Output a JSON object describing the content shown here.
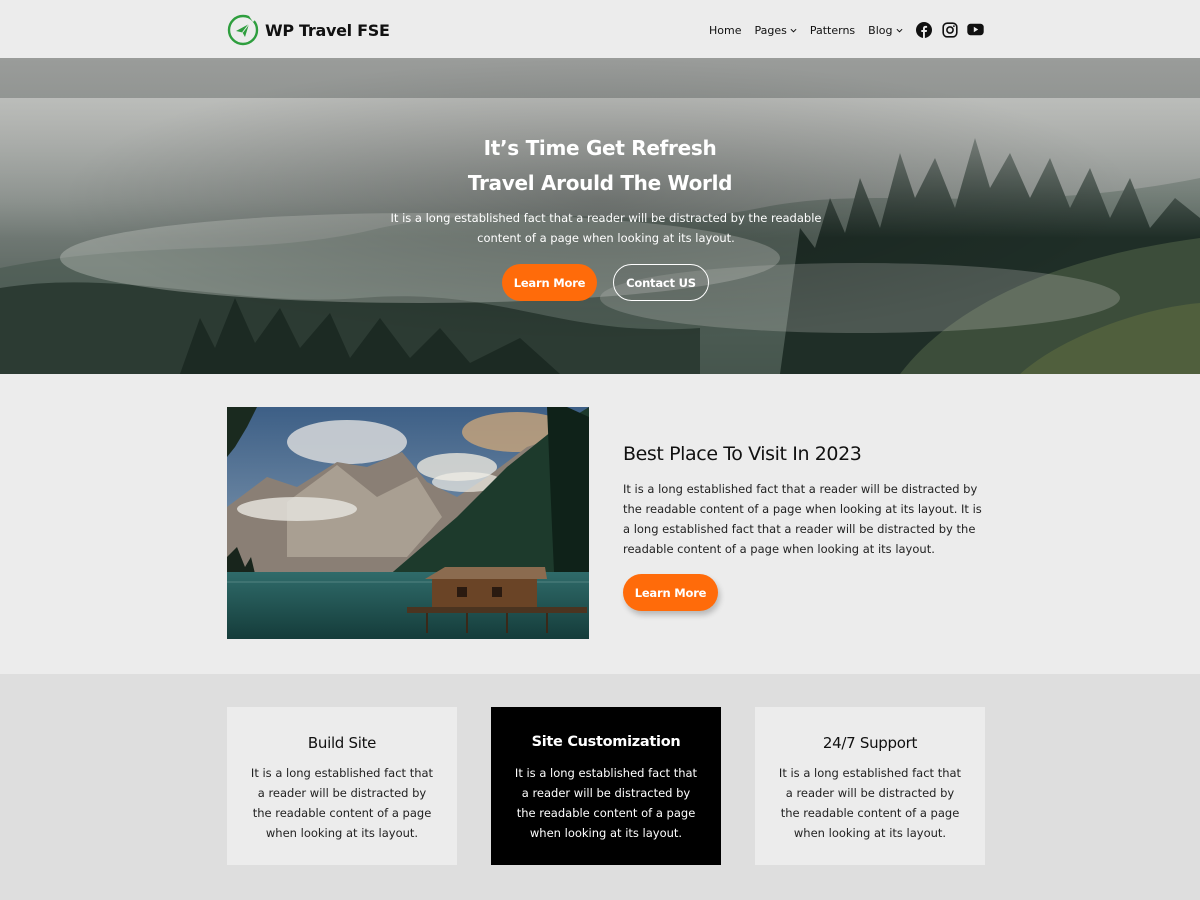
{
  "header": {
    "site_title": "WP Travel FSE",
    "nav": [
      {
        "label": "Home",
        "has_dropdown": false
      },
      {
        "label": "Pages",
        "has_dropdown": true
      },
      {
        "label": "Patterns",
        "has_dropdown": false
      },
      {
        "label": "Blog",
        "has_dropdown": true
      }
    ],
    "social": [
      "facebook-icon",
      "instagram-icon",
      "youtube-icon"
    ]
  },
  "hero": {
    "title_line1": "It’s Time Get Refresh",
    "title_line2": "Travel Arould The World",
    "text": "It is a long established fact that a reader will be distracted by the readable content of a page when looking at its layout.",
    "primary_button": "Learn More",
    "secondary_button": "Contact US"
  },
  "feature": {
    "title": "Best Place To Visit In 2023",
    "text": "It is a long established fact that a reader will be distracted by the readable content of a page when looking at its layout. It is a long established fact that a reader will be distracted by the readable content of a page when looking at its layout.",
    "button": "Learn More"
  },
  "services": [
    {
      "title": "Build Site",
      "text": "It is a long established fact that a reader will be distracted by the readable content of a page when looking at its layout."
    },
    {
      "title": "Site Customization",
      "text": "It is a long established fact that a reader will be distracted by the readable content of a page when looking at its layout."
    },
    {
      "title": "24/7 Support",
      "text": "It is a long established fact that a reader will be distracted by the readable content of a page when looking at its layout."
    }
  ],
  "colors": {
    "accent": "#ff6b0a",
    "logo_green": "#2e9e3e",
    "background": "#ececec",
    "section_alt": "#dedede",
    "dark_card": "#000000"
  }
}
